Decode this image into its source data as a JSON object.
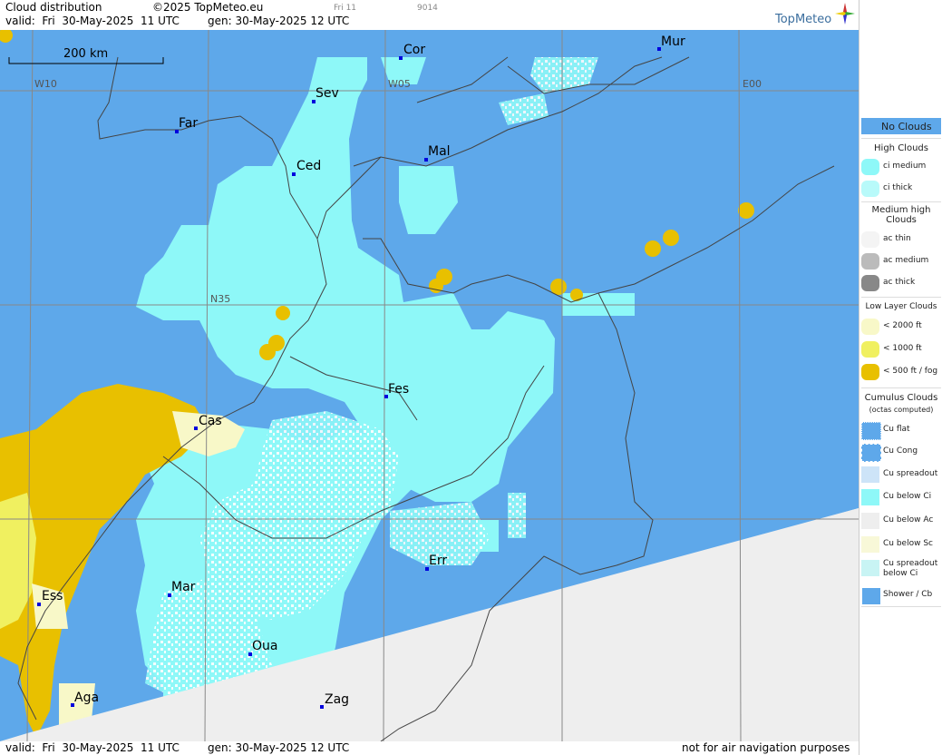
{
  "header": {
    "title": "Cloud distribution",
    "copyright": "©2025 TopMeteo.eu",
    "day_small": "Fri 11",
    "code_small": "9014",
    "valid": "valid:  Fri  30-May-2025  11 UTC",
    "generated": "gen: 30-May-2025 12 UTC",
    "logo": "TopMeteo"
  },
  "map": {
    "scale_label": "200 km",
    "grid_labels": [
      "W10",
      "W05",
      "E00",
      "N35"
    ],
    "cities": [
      {
        "name": "Cor"
      },
      {
        "name": "Mur"
      },
      {
        "name": "Sev"
      },
      {
        "name": "Far"
      },
      {
        "name": "Ced"
      },
      {
        "name": "Mal"
      },
      {
        "name": "Fes"
      },
      {
        "name": "Cas"
      },
      {
        "name": "Err"
      },
      {
        "name": "Mar"
      },
      {
        "name": "Ess"
      },
      {
        "name": "Oua"
      },
      {
        "name": "Aga"
      },
      {
        "name": "Zag"
      }
    ],
    "colors": {
      "no_clouds": "#5ea8ea",
      "ci": "#8ef8f8",
      "low_fog": "#e8c000",
      "low_1000": "#f0f060",
      "low_2000": "#f8f8c8",
      "no_data": "#eeeeee",
      "cu": "#ffffff"
    }
  },
  "footer": {
    "valid": "valid:  Fri  30-May-2025  11 UTC",
    "generated": "gen: 30-May-2025 12 UTC",
    "disclaimer": "not for air navigation purposes"
  },
  "legend": {
    "no_clouds": "No Clouds",
    "high_heading": "High Clouds",
    "ci_medium": "ci medium",
    "ci_thick": "ci thick",
    "medium_heading": "Medium high Clouds",
    "ac_thin": "ac thin",
    "ac_medium": "ac medium",
    "ac_thick": "ac thick",
    "low_heading": "Low Layer Clouds",
    "lt2000": "< 2000 ft",
    "lt1000": "< 1000 ft",
    "lt500": "< 500 ft / fog",
    "cumulus_heading": "Cumulus Clouds",
    "cumulus_sub": "(octas computed)",
    "cu_flat": "Cu flat",
    "cu_cong": "Cu Cong",
    "cu_spreadout": "Cu spreadout",
    "cu_below_ci": "Cu below Ci",
    "cu_below_ac": "Cu below Ac",
    "cu_below_sc": "Cu below Sc",
    "cu_spreadout_below_ci": "Cu spreadout below Ci",
    "shower_cb": "Shower / Cb"
  }
}
